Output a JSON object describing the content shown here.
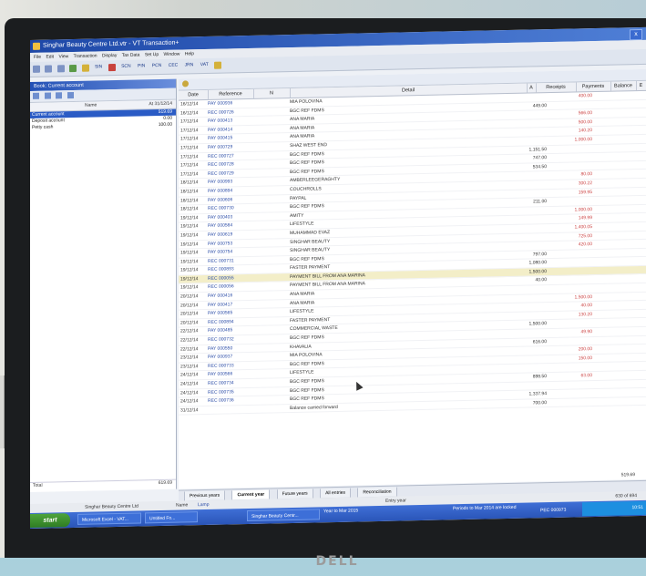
{
  "window": {
    "title": "Singhar Beauty Centre Ltd.vtr - VT Transaction+",
    "close_btn": "x"
  },
  "menu": [
    "File",
    "Edit",
    "View",
    "Transaction",
    "Display",
    "Tax Data",
    "Set Up",
    "Window",
    "Help"
  ],
  "toolbar": [
    "SIN",
    "SCN",
    "PIN",
    "PCN",
    "CEC",
    "JRN",
    "VAT"
  ],
  "left_panel": {
    "title": "Book: Current account",
    "col_name": "Name",
    "col_date": "At 31/12/14",
    "accounts": [
      {
        "name": "Current account",
        "amount": "519.69",
        "selected": true
      },
      {
        "name": "Deposit account",
        "amount": "0.00",
        "selected": false
      },
      {
        "name": "Petty cash",
        "amount": "100.00",
        "selected": false
      }
    ],
    "total_label": "Total",
    "total_amount": "619.69"
  },
  "table": {
    "columns": {
      "date": "Date",
      "ref": "Reference",
      "n": "N",
      "detail": "Detail",
      "a": "A",
      "receipts": "Receipts",
      "payments": "Payments",
      "balance": "Balance",
      "e": "E"
    },
    "rows": [
      {
        "date": "16/12/14",
        "ref": "PAY 000936",
        "detail": "MIA POLOVINA",
        "receipts": "",
        "payments": "400.00"
      },
      {
        "date": "16/12/14",
        "ref": "REC 000726",
        "detail": "BGC REF FDMS",
        "receipts": "449.00",
        "payments": ""
      },
      {
        "date": "17/12/14",
        "ref": "PAY 000413",
        "detail": "ANA MARIA",
        "receipts": "",
        "payments": "566.00"
      },
      {
        "date": "17/12/14",
        "ref": "PAY 000414",
        "detail": "ANA MARIA",
        "receipts": "",
        "payments": "500.00"
      },
      {
        "date": "17/12/14",
        "ref": "PAY 000415",
        "detail": "ANA MARIA",
        "receipts": "",
        "payments": "140.20"
      },
      {
        "date": "17/12/14",
        "ref": "PAY 000729",
        "detail": "SHAZ WEST END",
        "receipts": "",
        "payments": "1,000.00"
      },
      {
        "date": "17/12/14",
        "ref": "REC 000727",
        "detail": "BGC REF FDMS",
        "receipts": "1,151.50",
        "payments": ""
      },
      {
        "date": "17/12/14",
        "ref": "REC 000728",
        "detail": "BGC REF FDMS",
        "receipts": "747.00",
        "payments": ""
      },
      {
        "date": "17/12/14",
        "ref": "REC 000729",
        "detail": "BGC REF FDMS",
        "receipts": "534.50",
        "payments": ""
      },
      {
        "date": "18/12/14",
        "ref": "PAY 000993",
        "detail": "AMBERLEEGERAGHTY",
        "receipts": "",
        "payments": "80.00"
      },
      {
        "date": "18/12/14",
        "ref": "PAY 000894",
        "detail": "COUCHROLLS",
        "receipts": "",
        "payments": "300.22"
      },
      {
        "date": "18/12/14",
        "ref": "PAY 000606",
        "detail": "PAYPAL",
        "receipts": "",
        "payments": "159.95"
      },
      {
        "date": "18/12/14",
        "ref": "REC 000730",
        "detail": "BGC REF FDMS",
        "receipts": "211.00",
        "payments": ""
      },
      {
        "date": "19/12/14",
        "ref": "PAY 000403",
        "detail": "AMITY",
        "receipts": "",
        "payments": "1,000.00"
      },
      {
        "date": "19/12/14",
        "ref": "PAY 000584",
        "detail": "LIFESTYLE",
        "receipts": "",
        "payments": "149.99"
      },
      {
        "date": "19/12/14",
        "ref": "PAY 000619",
        "detail": "MUHAMMAD EVAZ",
        "receipts": "",
        "payments": "1,400.05"
      },
      {
        "date": "19/12/14",
        "ref": "PAY 000753",
        "detail": "SINGHAR BEAUTY",
        "receipts": "",
        "payments": "725.00"
      },
      {
        "date": "19/12/14",
        "ref": "PAY 000754",
        "detail": "SINGHAR BEAUTY",
        "receipts": "",
        "payments": "420.00"
      },
      {
        "date": "19/12/14",
        "ref": "REC 000731",
        "detail": "BGC REF FDMS",
        "receipts": "797.00",
        "payments": ""
      },
      {
        "date": "19/12/14",
        "ref": "REC 000893",
        "detail": "FASTER PAYMENT",
        "receipts": "1,080.00",
        "payments": ""
      },
      {
        "date": "19/12/14",
        "ref": "REC 000055",
        "detail": "PAYMENT BILL FROM ANA MARINA",
        "receipts": "1,500.00",
        "payments": "",
        "selected": true
      },
      {
        "date": "19/12/14",
        "ref": "REC 000056",
        "detail": "PAYMENT BILL FROM ANA MARINA",
        "receipts": "40.00",
        "payments": ""
      },
      {
        "date": "20/12/14",
        "ref": "PAY 000416",
        "detail": "ANA MARIA",
        "receipts": "",
        "payments": ""
      },
      {
        "date": "20/12/14",
        "ref": "PAY 000417",
        "detail": "ANA MARIA",
        "receipts": "",
        "payments": "1,500.00"
      },
      {
        "date": "20/12/14",
        "ref": "PAY 000565",
        "detail": "LIFESTYLE",
        "receipts": "",
        "payments": "40.00"
      },
      {
        "date": "20/12/14",
        "ref": "REC 000894",
        "detail": "FASTER PAYMENT",
        "receipts": "",
        "payments": "130.20"
      },
      {
        "date": "22/12/14",
        "ref": "PAY 000485",
        "detail": "COMMERCIAL WASTE",
        "receipts": "1,500.00",
        "payments": ""
      },
      {
        "date": "22/12/14",
        "ref": "REC 000732",
        "detail": "BGC REF FDMS",
        "receipts": "",
        "payments": "49.90"
      },
      {
        "date": "22/12/14",
        "ref": "PAY 000550",
        "detail": "KHAVALIA",
        "receipts": "616.00",
        "payments": ""
      },
      {
        "date": "23/12/14",
        "ref": "PAY 000937",
        "detail": "MIA POLOVINA",
        "receipts": "",
        "payments": "200.00"
      },
      {
        "date": "23/12/14",
        "ref": "REC 000733",
        "detail": "BGC REF FDMS",
        "receipts": "",
        "payments": "150.00"
      },
      {
        "date": "24/12/14",
        "ref": "PAY 000566",
        "detail": "LIFESTYLE",
        "receipts": "",
        "payments": ""
      },
      {
        "date": "24/12/14",
        "ref": "REC 000734",
        "detail": "BGC REF FDMS",
        "receipts": "898.50",
        "payments": "63.00"
      },
      {
        "date": "24/12/14",
        "ref": "REC 000735",
        "detail": "BGC REF FDMS",
        "receipts": "",
        "payments": ""
      },
      {
        "date": "24/12/14",
        "ref": "REC 000736",
        "detail": "BGC REF FDMS",
        "receipts": "1,337.94",
        "payments": ""
      },
      {
        "date": "31/12/14",
        "ref": "",
        "detail": "Balance carried forward",
        "receipts": "700.00",
        "payments": ""
      }
    ],
    "last_receipt": "400.00",
    "footer_total": "519.69"
  },
  "tabs": [
    "Previous years",
    "Current year",
    "Future years",
    "All entries",
    "Reconciliation"
  ],
  "name_label": "Name",
  "name_value": "Lamp",
  "status": {
    "left": "Singhar Beauty Centre Ltd",
    "middle": "Entry year",
    "right": "Periods to Mar 2014 are locked",
    "count": "630 of 694",
    "ref": "PEC 000973"
  },
  "taskbar": {
    "start": "start",
    "tasks": [
      "Microsoft Excel - VAT...",
      "Untitled Fo...",
      "Singhar Beauty Centr..."
    ],
    "period": "Year to Mar 2015",
    "tray": "10:51"
  },
  "brand": "DELL"
}
